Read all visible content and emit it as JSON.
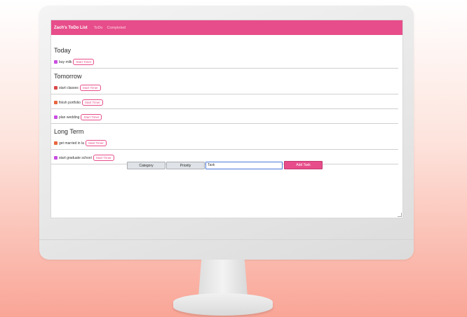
{
  "colors": {
    "accent": "#e74d8a",
    "category_purple": "#c84fe0",
    "category_red": "#d84848",
    "category_orange": "#e8663f"
  },
  "navbar": {
    "brand": "Zach's ToDo List",
    "links": [
      "ToDo",
      "Completed"
    ]
  },
  "sections": [
    {
      "heading": "Today",
      "tasks": [
        {
          "name": "buy milk",
          "category_color": "#c84fe0",
          "timer_label": "Start Timer"
        }
      ]
    },
    {
      "heading": "Tomorrow",
      "tasks": [
        {
          "name": "start classes",
          "category_color": "#d84848",
          "timer_label": "Start Timer"
        },
        {
          "name": "finish portfolio",
          "category_color": "#e8663f",
          "timer_label": "Start Timer"
        },
        {
          "name": "plan wedding",
          "category_color": "#c84fe0",
          "timer_label": "Start Timer"
        }
      ]
    },
    {
      "heading": "Long Term",
      "tasks": [
        {
          "name": "get married in la",
          "category_color": "#e8663f",
          "timer_label": "Start Timer"
        },
        {
          "name": "start graduate school",
          "category_color": "#c84fe0",
          "timer_label": "Start Timer"
        }
      ]
    }
  ],
  "add_form": {
    "category_label": "Category",
    "priority_label": "Priority",
    "task_value": "Task",
    "add_label": "Add Task"
  }
}
